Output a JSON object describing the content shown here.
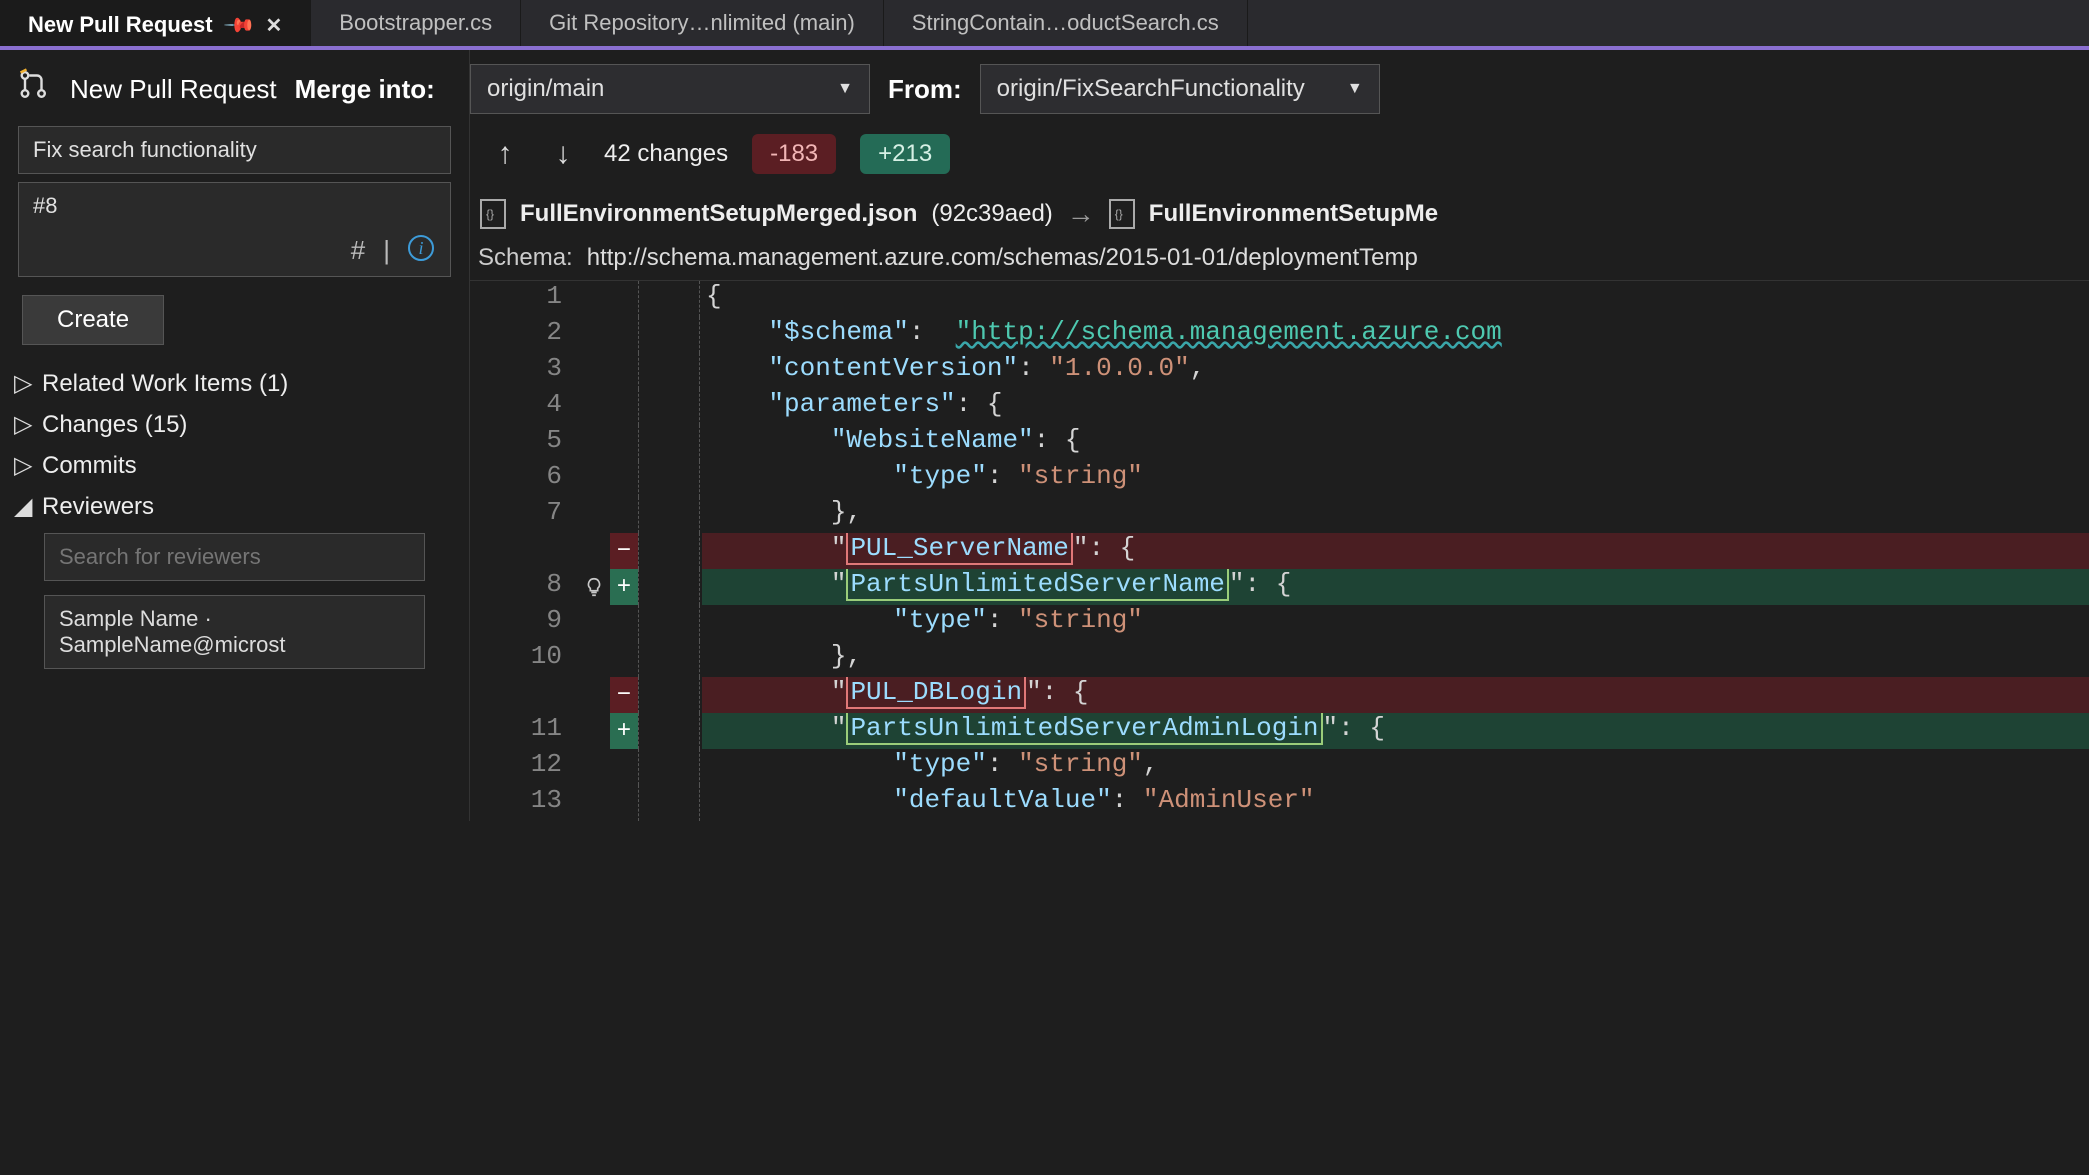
{
  "tabs": {
    "active": "New Pull Request",
    "t1": "Bootstrapper.cs",
    "t2": "Git Repository…nlimited (main)",
    "t3": "StringContain…oductSearch.cs"
  },
  "left": {
    "header_title": "New Pull Request",
    "merge_into_label": "Merge into:",
    "pr_title_value": "Fix search functionality",
    "pr_desc_value": "#8",
    "create_label": "Create",
    "tree": {
      "related": "Related Work Items (1)",
      "changes": "Changes (15)",
      "commits": "Commits",
      "reviewers": "Reviewers"
    },
    "reviewer_search_placeholder": "Search for reviewers",
    "reviewer_entry": "Sample Name · SampleName@microst"
  },
  "right": {
    "merge_into_value": "origin/main",
    "from_label": "From:",
    "from_value": "origin/FixSearchFunctionality",
    "changes_text": "42 changes",
    "deletions": "-183",
    "additions": "+213",
    "file_left_name": "FullEnvironmentSetupMerged.json",
    "file_left_rev": "(92c39aed)",
    "file_right_name": "FullEnvironmentSetupMe",
    "schema_label": "Schema:",
    "schema_value": "http://schema.management.azure.com/schemas/2015-01-01/deploymentTemp"
  },
  "code": {
    "ln1": "1",
    "ln2": "2",
    "ln3": "3",
    "ln4": "4",
    "ln5": "5",
    "ln6": "6",
    "ln7": "7",
    "ln8": "8",
    "ln9": "9",
    "ln10": "10",
    "ln11": "11",
    "ln12": "12",
    "ln13": "13",
    "c1": "{",
    "c2_key": "\"$schema\"",
    "c2_url": "\"http://schema.management.azure.com",
    "c3_key": "\"contentVersion\"",
    "c3_val": "\"1.0.0.0\"",
    "c4_key": "\"parameters\"",
    "c5_key": "\"WebsiteName\"",
    "c6_key": "\"type\"",
    "c6_val": "\"string\"",
    "del1_key": "PUL_ServerName",
    "add1_key": "PartsUnlimitedServerName",
    "del2_key": "PUL_DBLogin",
    "add2_key": "PartsUnlimitedServerAdminLogin",
    "c12_key": "\"type\"",
    "c12_val": "\"string\"",
    "c13_key": "\"defaultValue\"",
    "c13_val": "\"AdminUser\""
  }
}
